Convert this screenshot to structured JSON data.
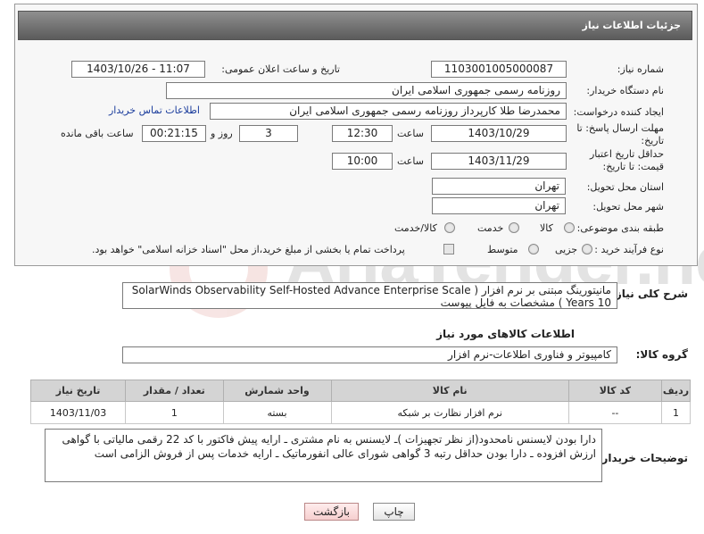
{
  "header": {
    "title": "جزئیات اطلاعات نیاز"
  },
  "form": {
    "need_number_label": "شماره نیاز:",
    "need_number": "1103001005000087",
    "announce_label": "تاریخ و ساعت اعلان عمومی:",
    "announce_value": "1403/10/26 - 11:07",
    "buyer_org_label": "نام دستگاه خریدار:",
    "buyer_org": "روزنامه رسمی جمهوری اسلامی ایران",
    "creator_label": "ایجاد کننده درخواست:",
    "creator": "محمدرضا طلا کارپرداز روزنامه رسمی جمهوری اسلامی ایران",
    "contact_link": "اطلاعات تماس خریدار",
    "deadline_label": "مهلت ارسال پاسخ: تا تاریخ:",
    "deadline_date": "1403/10/29",
    "time_label": "ساعت",
    "deadline_time": "12:30",
    "days_value": "3",
    "days_label": "روز و",
    "remaining_time": "00:21:15",
    "remaining_label": "ساعت باقی مانده",
    "validity_label": "حداقل تاریخ اعتبار قیمت: تا تاریخ:",
    "validity_date": "1403/11/29",
    "validity_time": "10:00",
    "province_label": "استان محل تحویل:",
    "province": "تهران",
    "city_label": "شهر محل تحویل:",
    "city": "تهران",
    "category_label": "طبقه بندی موضوعی:",
    "category_options": [
      "کالا",
      "خدمت",
      "کالا/خدمت"
    ],
    "purchase_type_label": "نوع فرآیند خرید :",
    "purchase_options": [
      "جزیی",
      "متوسط"
    ],
    "payment_note": "پرداخت تمام یا بخشی از مبلغ خرید،از محل \"اسناد خزانه اسلامی\" خواهد بود."
  },
  "watermark": {
    "text": "AriaTender.neT"
  },
  "summary": {
    "label": "شرح کلی نیاز:",
    "line1": "مانیتورینگ مبتنی بر نرم افزار ( SolarWinds Observability Self-Hosted Advance Enterprise Scale",
    "line2": "10 Years ) مشخصات به فایل پیوست"
  },
  "goods_section": {
    "title": "اطلاعات کالاهای مورد نیاز",
    "group_label": "گروه کالا:",
    "group_value": "کامپیوتر و فناوری اطلاعات-نرم افزار"
  },
  "table": {
    "headers": [
      "ردیف",
      "کد کالا",
      "نام کالا",
      "واحد شمارش",
      "تعداد / مقدار",
      "تاریخ نیاز"
    ],
    "rows": [
      [
        "1",
        "--",
        "نرم افزار نظارت بر شبکه",
        "بسته",
        "1",
        "1403/11/03"
      ]
    ]
  },
  "buyer_notes": {
    "label": "توضیحات خریدار:",
    "text": "دارا بودن لایسنس نامحدود(از نظر تجهیزات )ـ لایسنس به نام مشتری ـ ارایه پیش فاکتور با کد 22 رقمی مالیاتی با گواهی ارزش افزوده ـ دارا بودن حداقل رتبه 3 گواهی شورای عالی انفورماتیک ـ ارایه خدمات پس از فروش الزامی است"
  },
  "buttons": {
    "print": "چاپ",
    "back": "بازگشت"
  }
}
